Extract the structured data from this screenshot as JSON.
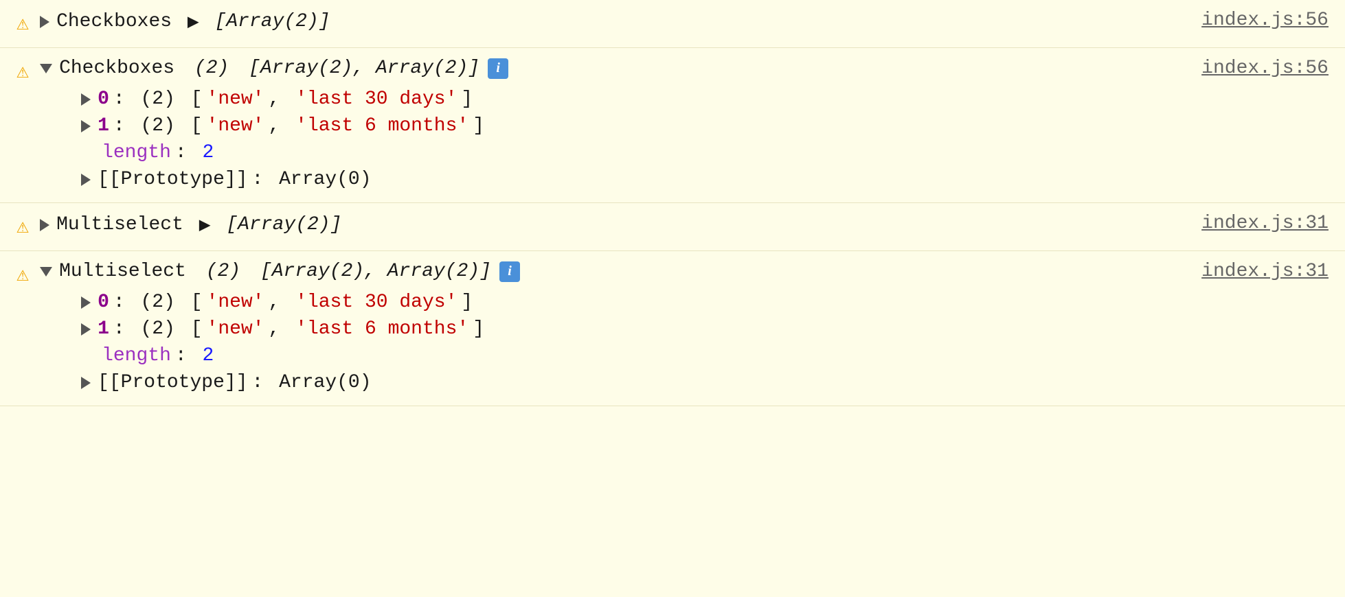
{
  "colors": {
    "background": "#fefde8",
    "border": "#e8e4c0",
    "warning": "#f0a500",
    "black": "#1a1a1a",
    "blue_num": "#1a1aff",
    "red_string": "#c00000",
    "purple_bold": "#8b008b",
    "purple_length": "#9b30c0",
    "link": "#666666",
    "info_badge_bg": "#4a90d9"
  },
  "rows": [
    {
      "id": "row1",
      "warning": "⚠",
      "label": "Checkboxes",
      "collapsed": true,
      "array_display": "[Array(2)]",
      "file_link": "index.js:56",
      "expanded": false
    },
    {
      "id": "row2",
      "warning": "⚠",
      "label": "Checkboxes",
      "collapsed": false,
      "array_count": "(2)",
      "array_display": "[Array(2), Array(2)]",
      "has_info": true,
      "file_link": "index.js:56",
      "expanded": true,
      "items": [
        {
          "index": "0",
          "count": "(2)",
          "values": [
            "'new'",
            "'last 30 days'"
          ]
        },
        {
          "index": "1",
          "count": "(2)",
          "values": [
            "'new'",
            "'last 6 months'"
          ]
        }
      ],
      "length_label": "length",
      "length_value": "2",
      "prototype_label": "[[Prototype]]",
      "prototype_value": "Array(0)"
    },
    {
      "id": "row3",
      "warning": "⚠",
      "label": "Multiselect",
      "collapsed": true,
      "array_display": "[Array(2)]",
      "file_link": "index.js:31",
      "expanded": false
    },
    {
      "id": "row4",
      "warning": "⚠",
      "label": "Multiselect",
      "collapsed": false,
      "array_count": "(2)",
      "array_display": "[Array(2), Array(2)]",
      "has_info": true,
      "file_link": "index.js:31",
      "expanded": true,
      "items": [
        {
          "index": "0",
          "count": "(2)",
          "values": [
            "'new'",
            "'last 30 days'"
          ]
        },
        {
          "index": "1",
          "count": "(2)",
          "values": [
            "'new'",
            "'last 6 months'"
          ]
        }
      ],
      "length_label": "length",
      "length_value": "2",
      "prototype_label": "[[Prototype]]",
      "prototype_value": "Array(0)"
    }
  ]
}
